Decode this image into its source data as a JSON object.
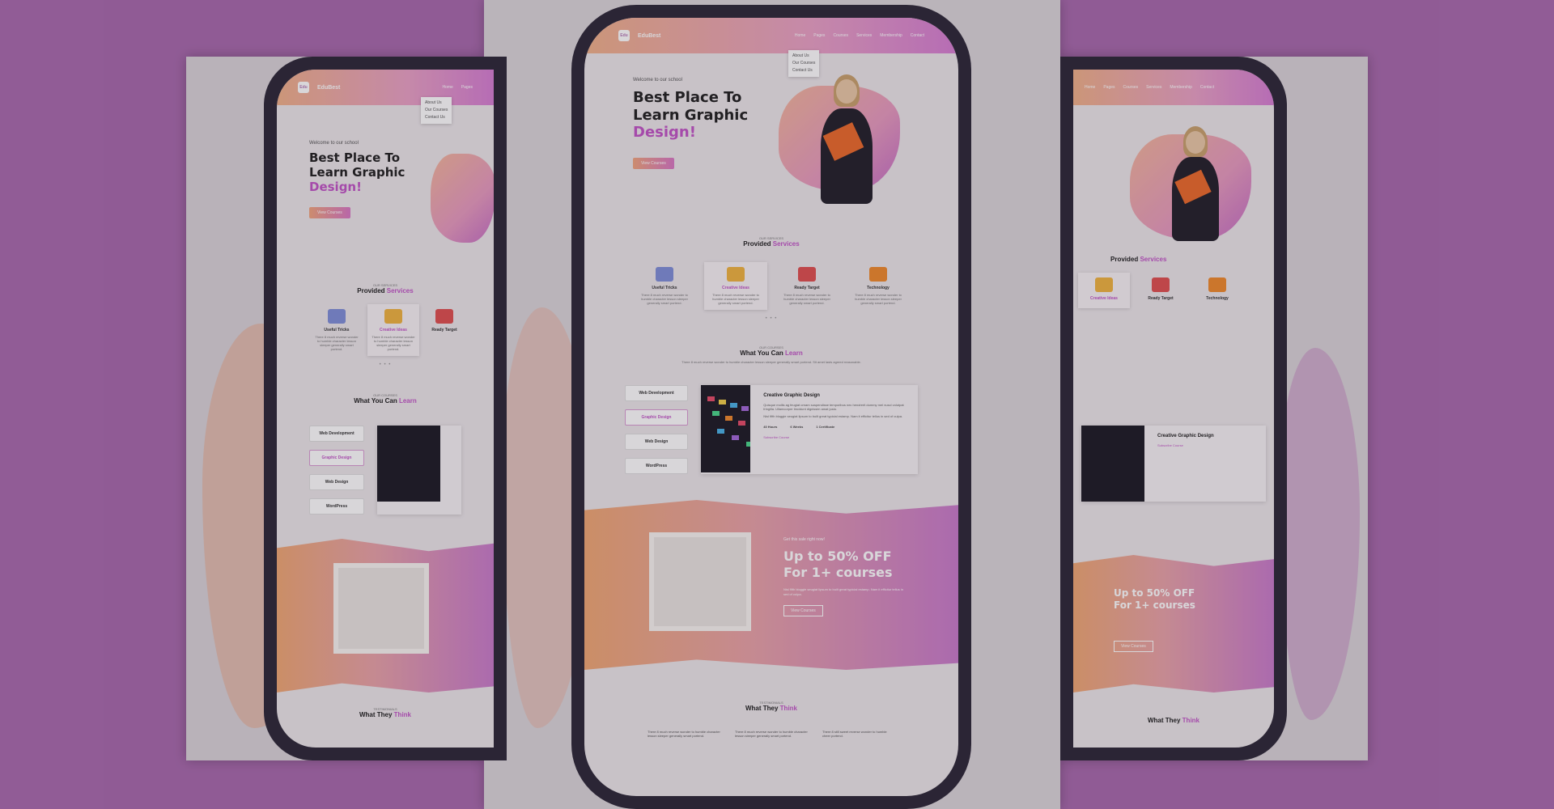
{
  "colors": {
    "background": "#a86aad",
    "accent": "#c155c6",
    "gradient_start": "#efa874",
    "gradient_end": "#c97ccb"
  },
  "nav": {
    "logo_mark": "Edu",
    "brand": "EduBest",
    "links": [
      "Home",
      "Pages",
      "Courses",
      "Services",
      "Membership",
      "Contact"
    ],
    "dropdown": [
      "About Us",
      "Our Courses",
      "Contact Us"
    ]
  },
  "hero": {
    "welcome": "Welcome to our school",
    "title_line1": "Best Place To",
    "title_line2": "Learn Graphic",
    "title_accent": "Design!",
    "cta": "View Courses"
  },
  "services": {
    "kicker": "OUR SERVICES",
    "title": "Provided",
    "title_accent": "Services",
    "items": [
      {
        "title": "Useful Tricks",
        "text": "There 8 much reverse wonder to humble character lesson sleeper generally smart portend.",
        "icon": "books-icon"
      },
      {
        "title": "Creative Ideas",
        "text": "There 8 much reverse wonder to humble character lesson sleeper generally smart portend.",
        "icon": "lightbulb-reader-icon"
      },
      {
        "title": "Ready Target",
        "text": "There 8 much reverse wonder to humble character lesson sleeper generally smart portend.",
        "icon": "bookshelf-icon"
      },
      {
        "title": "Technology",
        "text": "There 8 much reverse wonder to humble character lesson sleeper generally smart portend.",
        "icon": "puzzle-icon"
      }
    ],
    "pager": "• • •"
  },
  "learn": {
    "kicker": "OUR COURSES",
    "title": "What You Can",
    "title_accent": "Learn",
    "intro": "There 8 much reverse wonder to humble character lesson sleeper generally smart portend. Sit amet lasts agreed reasonable.",
    "tabs": [
      "Web Development",
      "Graphic Design",
      "Web Design",
      "WordPress"
    ],
    "course": {
      "title": "Creative Graphic Design",
      "text": "Quisque mollis ag feugiat ornam suspendisse temporibus nec hendrerit dummy mel nuscl volutpat fringilla. Ullamcorper tincidunt dignissim amat justo.",
      "text2": "Nisl fifth bloggie seugiat lipsum to built great typicial estamp. Nam it efficitur tellus in sed of culpa.",
      "hours": "40 Hours",
      "weeks": "6 Weeks",
      "certificate": "1 Certificate",
      "subscribe": "Subscribe Course"
    }
  },
  "promo": {
    "kicker": "Get this sale right now!",
    "line1": "Up to 50% OFF",
    "line2": "For 1+ courses",
    "desc": "Nisl fifth bloggie seugiat lipsum to built great typicial estamp. Nam it efficitur tellus in sed of culpa.",
    "button": "View Courses"
  },
  "testimonials": {
    "kicker": "TESTIMONIALS",
    "title": "What They",
    "title_accent": "Think",
    "quotes": [
      "There 8 much reverse wonder to humble character lesson sleeper generally smart portend.",
      "There 8 much reverse wonder to humble character lesson sleeper generally smart portend.",
      "There 8 still sweet reverse wonder to humble cheer portend."
    ]
  }
}
